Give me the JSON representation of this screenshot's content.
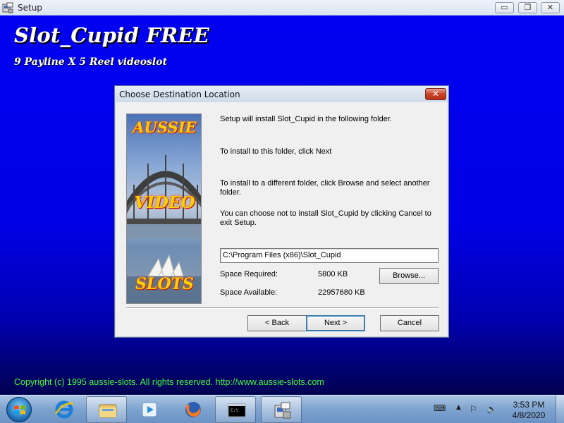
{
  "window": {
    "title": "Setup",
    "minimize_glyph": "▭",
    "maximize_glyph": "❐",
    "close_glyph": "✕"
  },
  "background": {
    "app_title": "Slot_Cupid FREE",
    "app_subtitle": "9 Payline X 5 Reel videoslot",
    "copyright": "Copyright (c) 1995 aussie-slots. All rights reserved. http://www.aussie-slots.com"
  },
  "dialog": {
    "title": "Choose Destination Location",
    "close_glyph": "✕",
    "banner_words": [
      "AUSSIE",
      "VIDEO",
      "SLOTS"
    ],
    "para1": "Setup will install Slot_Cupid in the following folder.",
    "para2": "To install to this folder, click Next",
    "para3": "To install to a different folder, click Browse and select another folder.",
    "para4": "You can choose not to install Slot_Cupid by clicking Cancel to exit Setup.",
    "destination_path": "C:\\Program Files (x86)\\Slot_Cupid",
    "space_required_label": "Space Required:",
    "space_required_value": "5800 KB",
    "space_available_label": "Space Available:",
    "space_available_value": "22957680 KB",
    "browse_label": "Browse...",
    "back_label": "< Back",
    "next_label": "Next >",
    "cancel_label": "Cancel"
  },
  "taskbar": {
    "pinned": [
      "internet-explorer-icon",
      "folder-icon",
      "media-player-icon",
      "firefox-icon",
      "command-prompt-icon",
      "setup-icon"
    ],
    "cmd_text": "C:\\",
    "clock_time": "3:53 PM",
    "clock_date": "4/8/2020"
  },
  "colors": {
    "background_blue": "#0000e0",
    "copyright_green": "#3cff3c"
  }
}
